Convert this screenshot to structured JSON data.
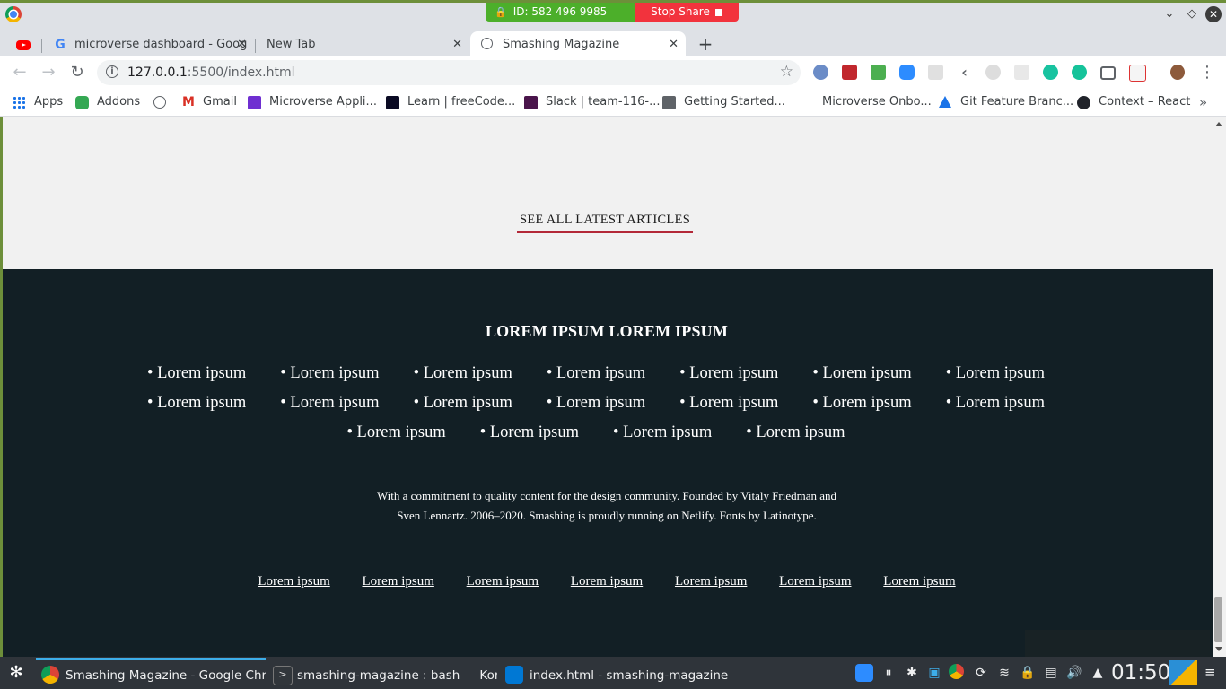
{
  "share_bar": {
    "id_label": "ID: 582 496 9985",
    "stop_label": "Stop Share"
  },
  "tabs": [
    {
      "label": "microverse dashboard - Goog",
      "icon": "google-icon"
    },
    {
      "label": "New Tab",
      "icon": "none"
    },
    {
      "label": "Smashing Magazine",
      "icon": "globe-icon"
    }
  ],
  "toolbar": {
    "url_host": "127.0.0.1",
    "url_path": ":5500/index.html"
  },
  "bookmarks": [
    {
      "label": "Apps",
      "color": "#1a73e8"
    },
    {
      "label": "Addons",
      "color": "#34a853"
    },
    {
      "label": "",
      "color": "#5f6368"
    },
    {
      "label": "Gmail",
      "color": "#d93025"
    },
    {
      "label": "Microverse Appli...",
      "color": "#6f2fd1"
    },
    {
      "label": "Learn | freeCode...",
      "color": "#0a0a23"
    },
    {
      "label": "Slack | team-116-...",
      "color": "#4a154b"
    },
    {
      "label": "Getting Started...",
      "color": "#5f6368"
    },
    {
      "label": "Microverse Onbo...",
      "color": "#ffffff"
    },
    {
      "label": "Git Feature Branc...",
      "color": "#1a73e8"
    },
    {
      "label": "Context – React",
      "color": "#20232a"
    }
  ],
  "page": {
    "see_all": "SEE ALL LATEST ARTICLES",
    "footer_title": "LOREM IPSUM LOREM IPSUM",
    "footer_links": [
      "Lorem ipsum",
      "Lorem ipsum",
      "Lorem ipsum",
      "Lorem ipsum",
      "Lorem ipsum",
      "Lorem ipsum",
      "Lorem ipsum",
      "Lorem ipsum",
      "Lorem ipsum",
      "Lorem ipsum",
      "Lorem ipsum",
      "Lorem ipsum",
      "Lorem ipsum",
      "Lorem ipsum",
      "Lorem ipsum",
      "Lorem ipsum",
      "Lorem ipsum",
      "Lorem ipsum"
    ],
    "about_line1": "With a commitment to quality content for the design community. Founded by Vitaly Friedman and",
    "about_line2": "Sven Lennartz. 2006–2020. Smashing is proudly running on Netlify. Fonts by Latinotype.",
    "bottom_links": [
      "Lorem ipsum",
      "Lorem ipsum",
      "Lorem ipsum",
      "Lorem ipsum",
      "Lorem ipsum",
      "Lorem ipsum",
      "Lorem ipsum"
    ]
  },
  "taskbar": {
    "tasks": [
      {
        "label": "Smashing Magazine - Google Chro...",
        "icon": "chrome-icon"
      },
      {
        "label": "smashing-magazine : bash — Kon...",
        "icon": "konsole-icon"
      },
      {
        "label": "index.html - smashing-magazine - ...",
        "icon": "vscode-icon"
      }
    ],
    "clock": "01:50"
  },
  "colors": {
    "footer_bg": "#121f25",
    "accent_underline": "#b32838",
    "page_bg": "#f1f1f1"
  }
}
